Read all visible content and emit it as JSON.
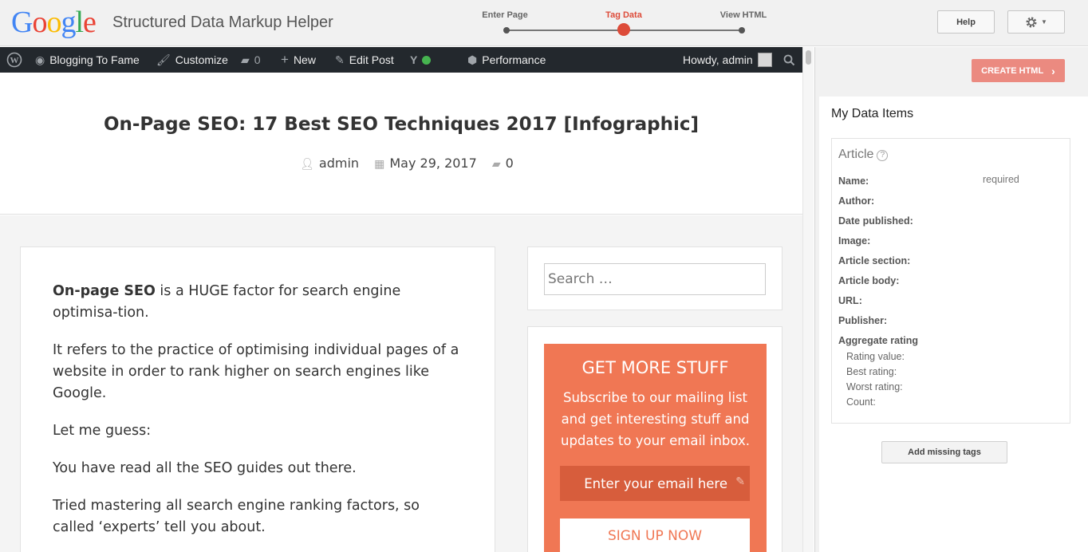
{
  "header": {
    "logo_letters": [
      {
        "ch": "G",
        "color": "#4285f4"
      },
      {
        "ch": "o",
        "color": "#ea4335"
      },
      {
        "ch": "o",
        "color": "#fbbc05"
      },
      {
        "ch": "g",
        "color": "#4285f4"
      },
      {
        "ch": "l",
        "color": "#34a853"
      },
      {
        "ch": "e",
        "color": "#ea4335"
      }
    ],
    "tool_title": "Structured Data Markup Helper",
    "steps": [
      "Enter Page",
      "Tag Data",
      "View HTML"
    ],
    "active_step": "Tag Data",
    "help_label": "Help",
    "settings_icon": "gear-icon"
  },
  "wpbar": {
    "site_name": "Blogging To Fame",
    "customize": "Customize",
    "comments_count": "0",
    "new_label": "New",
    "edit_post": "Edit Post",
    "performance": "Performance",
    "greeting": "Howdy, admin"
  },
  "post": {
    "title": "On-Page SEO: 17 Best SEO Techniques 2017 [Infographic]",
    "author": "admin",
    "date": "May 29, 2017",
    "comments": "0",
    "paragraphs": [
      {
        "bold": "On-page SEO",
        "text": " is a HUGE factor for search engine optimisa-tion."
      },
      {
        "bold": "",
        "text": "It refers to the practice of optimising individual pages of a website in order to rank higher on search engines like Google."
      },
      {
        "bold": "",
        "text": "Let me guess:"
      },
      {
        "bold": "",
        "text": "You have read all the SEO guides out there."
      },
      {
        "bold": "",
        "text": "Tried mastering all search engine ranking factors, so called ‘experts’ tell you about."
      }
    ]
  },
  "sidebar": {
    "search_placeholder": "Search …",
    "subscribe": {
      "title": "GET MORE STUFF",
      "text": "Subscribe to our mailing list and get interesting stuff and updates to your email inbox.",
      "email_placeholder": "Enter your email here",
      "button": "SIGN UP NOW",
      "accent": "#f07754"
    }
  },
  "panel": {
    "create_html": "CREATE HTML",
    "heading": "My Data Items",
    "item_type": "Article",
    "required_note": "required",
    "fields": [
      "Name:",
      "Author:",
      "Date published:",
      "Image:",
      "Article section:",
      "Article body:",
      "URL:",
      "Publisher:",
      "Aggregate rating"
    ],
    "rating_subfields": [
      "Rating value:",
      "Best rating:",
      "Worst rating:",
      "Count:"
    ],
    "add_missing": "Add missing tags"
  }
}
